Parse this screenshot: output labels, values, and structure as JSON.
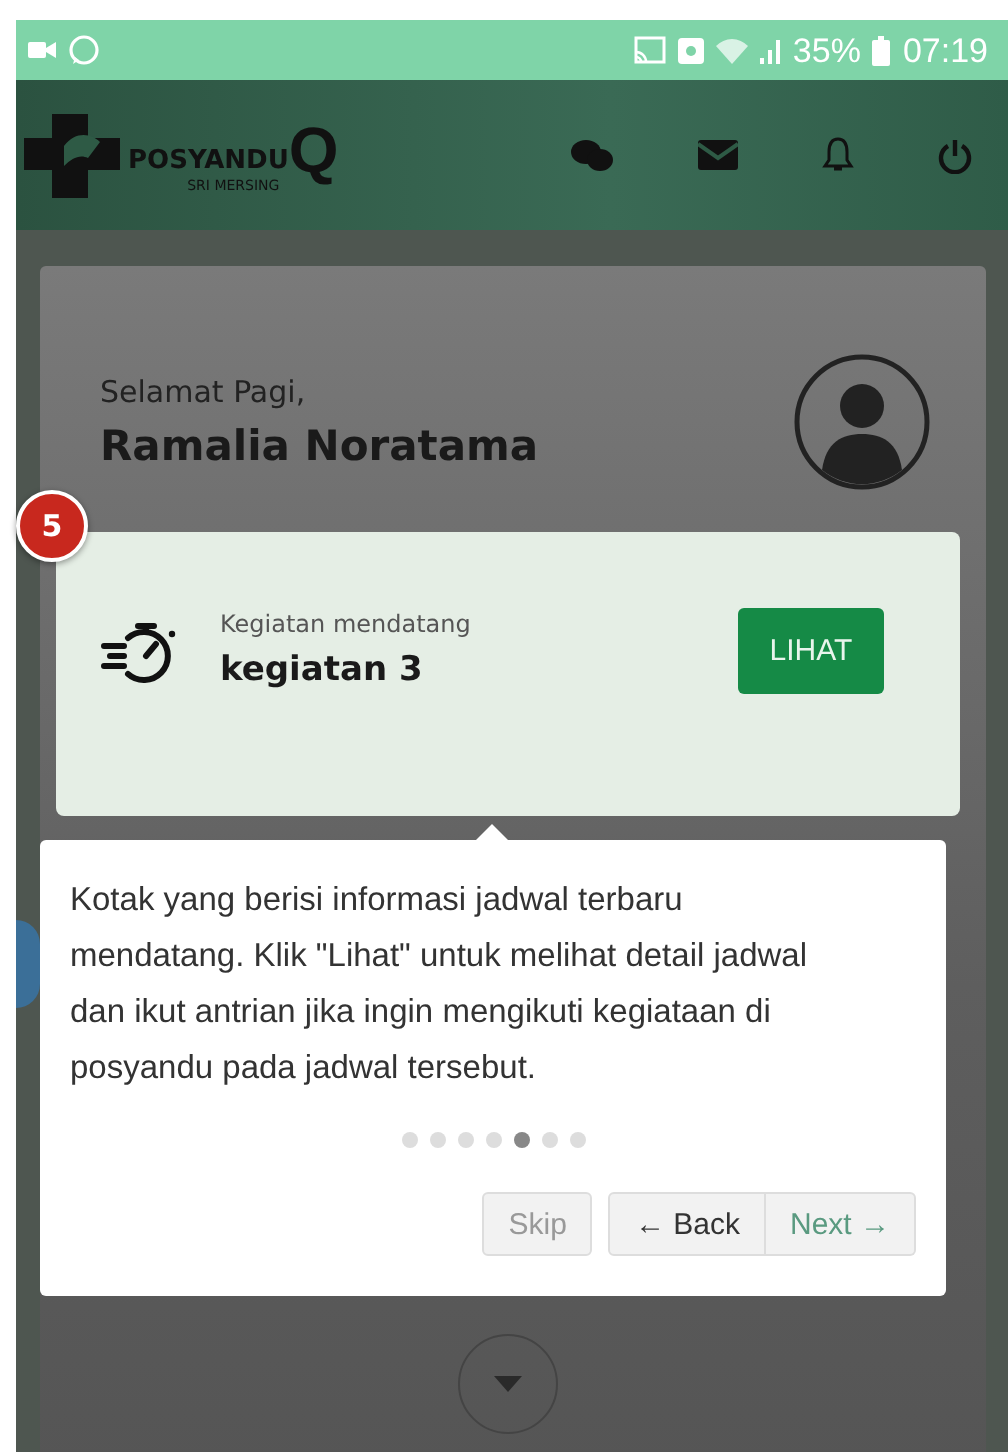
{
  "status_bar": {
    "battery": "35%",
    "time": "07:19"
  },
  "header": {
    "logo_name": "POSYANDU",
    "logo_letter": "Q",
    "logo_subtitle": "SRI MERSING"
  },
  "greeting": {
    "salutation": "Selamat Pagi,",
    "name": "Ramalia Noratama"
  },
  "tour": {
    "step_badge": "5",
    "highlight": {
      "label": "Kegiatan mendatang",
      "title": "kegiatan 3",
      "button": "LIHAT"
    },
    "text": "Kotak yang berisi informasi jadwal terbaru mendatang. Klik \"Lihat\" untuk melihat detail jadwal dan ikut antrian jika ingin mengikuti kegiataan di posyandu pada jadwal tersebut.",
    "steps": [
      {
        "selected": false
      },
      {
        "selected": false
      },
      {
        "selected": false
      },
      {
        "selected": false
      },
      {
        "selected": true
      },
      {
        "selected": false
      },
      {
        "selected": false
      }
    ],
    "buttons": [
      {
        "label": "Skip",
        "kind": "skip"
      },
      {
        "label": "← Back",
        "kind": "back"
      },
      {
        "label": "Next →",
        "kind": "next"
      }
    ]
  }
}
